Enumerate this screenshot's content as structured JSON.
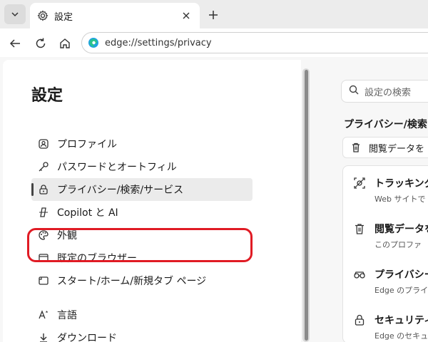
{
  "tab": {
    "title": "設定"
  },
  "address": {
    "url": "edge://settings/privacy"
  },
  "settings": {
    "title": "設定",
    "nav": [
      {
        "label": "プロファイル",
        "icon": "profile-icon"
      },
      {
        "label": "パスワードとオートフィル",
        "icon": "key-icon"
      },
      {
        "label": "プライバシー/検索/サービス",
        "icon": "lock-icon",
        "active": true
      },
      {
        "label": "Copilot と AI",
        "icon": "copilot-icon"
      },
      {
        "label": "外観",
        "icon": "palette-icon"
      },
      {
        "label": "既定のブラウザー",
        "icon": "browser-icon"
      },
      {
        "label": "スタート/ホーム/新規タブ ページ",
        "icon": "home-icon"
      },
      {
        "label": "言語",
        "icon": "language-icon"
      },
      {
        "label": "ダウンロード",
        "icon": "download-icon"
      }
    ]
  },
  "right": {
    "search_placeholder": "設定の検索",
    "section_title": "プライバシー/検索",
    "clear_label": "閲覧データを",
    "items": [
      {
        "title": "トラッキング",
        "sub": "Web サイトで"
      },
      {
        "title": "閲覧データを",
        "sub": "このプロファ"
      },
      {
        "title": "プライバシー",
        "sub": "Edge のプライ"
      },
      {
        "title": "セキュリティ",
        "sub": "Edge のセキュ"
      }
    ]
  },
  "colors": {
    "highlight": "#e01b24",
    "accent": "#1a1a1a"
  }
}
